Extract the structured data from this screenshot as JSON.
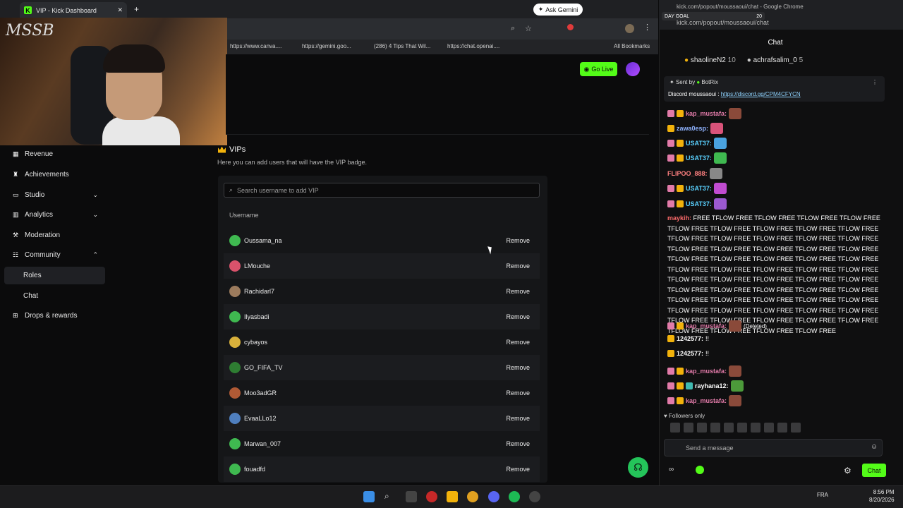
{
  "browser": {
    "tab_title": "VIP - Kick Dashboard",
    "ask_gemini": "Ask Gemini",
    "bookmarks": [
      "https://www.canva....",
      "https://gemini.goo...",
      "(286) 4 Tips That Wil...",
      "https://chat.openai...."
    ],
    "all_bookmarks": "All Bookmarks"
  },
  "cam": {
    "logo": "MSSB"
  },
  "header": {
    "go_live": "Go Live"
  },
  "sidebar": {
    "items": [
      {
        "label": "Revenue"
      },
      {
        "label": "Achievements"
      },
      {
        "label": "Studio"
      },
      {
        "label": "Analytics"
      },
      {
        "label": "Moderation"
      },
      {
        "label": "Community"
      },
      {
        "label": "Roles"
      },
      {
        "label": "Chat"
      },
      {
        "label": "Drops & rewards"
      }
    ]
  },
  "vips": {
    "title": "VIPs",
    "description": "Here you can add users that will have the VIP badge.",
    "search_placeholder": "Search username to add VIP",
    "column_username": "Username",
    "remove_label": "Remove",
    "users": [
      {
        "name": "Oussama_na",
        "color": "#3fb950"
      },
      {
        "name": "LMouche",
        "color": "#d9526b"
      },
      {
        "name": "Rachidarl7",
        "color": "#9c7b5d"
      },
      {
        "name": "Ilyasbadi",
        "color": "#3fb950"
      },
      {
        "name": "cybayos",
        "color": "#d9b13b"
      },
      {
        "name": "GO_FIFA_TV",
        "color": "#2e7d32"
      },
      {
        "name": "Moo3adGR",
        "color": "#b05a35"
      },
      {
        "name": "EvaaLLo12",
        "color": "#4f7fbf"
      },
      {
        "name": "Marwan_007",
        "color": "#3fb950"
      },
      {
        "name": "fouadfd",
        "color": "#3fb950"
      }
    ]
  },
  "chat": {
    "url": "kick.com/popout/moussaoui/chat - Google Chrome",
    "url2": "kick.com/popout/moussaoui/chat",
    "day_goal": "DAY GOAL",
    "day_goal_value": "20",
    "header": "Chat",
    "leaders": [
      {
        "name": "shaolineN2",
        "count": "10"
      },
      {
        "name": "achrafsalim_0",
        "count": "5"
      }
    ],
    "pinned_sent_by": "Sent by",
    "pinned_bot": "BotRix",
    "pinned_text": "Discord moussaoui :",
    "pinned_link": "https://discord.gg/CPM4CFYCN",
    "messages": [
      {
        "user": "kap_mustafa:",
        "color": "#e27ba9",
        "extra": ""
      },
      {
        "user": "zawa0esp:",
        "color": "#8fb3ff",
        "extra": ""
      },
      {
        "user": "USAT37:",
        "color": "#5ad1ff",
        "extra": ""
      },
      {
        "user": "USAT37:",
        "color": "#5ad1ff",
        "extra": ""
      },
      {
        "user": "FLIPOO_888:",
        "color": "#ff8080",
        "extra": ""
      },
      {
        "user": "USAT37:",
        "color": "#5ad1ff",
        "extra": ""
      },
      {
        "user": "USAT37:",
        "color": "#5ad1ff",
        "extra": ""
      }
    ],
    "spam_user": "maykih:",
    "spam_text": "FREE TFLOW FREE TFLOW FREE TFLOW FREE TFLOW FREE TFLOW FREE TFLOW FREE TFLOW FREE TFLOW FREE TFLOW FREE TFLOW FREE TFLOW FREE TFLOW FREE TFLOW FREE TFLOW FREE TFLOW FREE TFLOW FREE TFLOW FREE TFLOW FREE TFLOW FREE TFLOW FREE TFLOW FREE TFLOW FREE TFLOW FREE TFLOW FREE TFLOW FREE TFLOW FREE TFLOW FREE TFLOW FREE TFLOW FREE TFLOW FREE TFLOW FREE TFLOW FREE TFLOW FREE TFLOW FREE TFLOW FREE TFLOW FREE TFLOW FREE TFLOW FREE TFLOW FREE TFLOW FREE TFLOW FREE TFLOW FREE TFLOW FREE TFLOW FREE TFLOW FREE TFLOW FREE TFLOW FREE TFLOW FREE TFLOW FREE TFLOW FREE TFLOW FREE TFLOW FREE TFLOW FREE TFLOW FREE TFLOW FREE TFLOW FREE TFLOW FREE TFLOW FREE",
    "later": [
      {
        "user": "kap_mustafa:",
        "color": "#e27ba9",
        "extra": "(Deleted)"
      },
      {
        "user": "1242577:",
        "color": "#ffffff",
        "extra": "!!"
      },
      {
        "user": "1242577:",
        "color": "#ffffff",
        "extra": "!!"
      },
      {
        "user": "kap_mustafa:",
        "color": "#e27ba9",
        "extra": ""
      },
      {
        "user": "rayhana12:",
        "color": "#ffffff",
        "extra": ""
      },
      {
        "user": "kap_mustafa:",
        "color": "#e27ba9",
        "extra": ""
      }
    ],
    "followers_only": "Followers only",
    "send_placeholder": "Send a message",
    "chat_button": "Chat"
  },
  "taskbar": {
    "lang": "FRA",
    "time": "8:56 PM",
    "date": "8/20/2026"
  }
}
